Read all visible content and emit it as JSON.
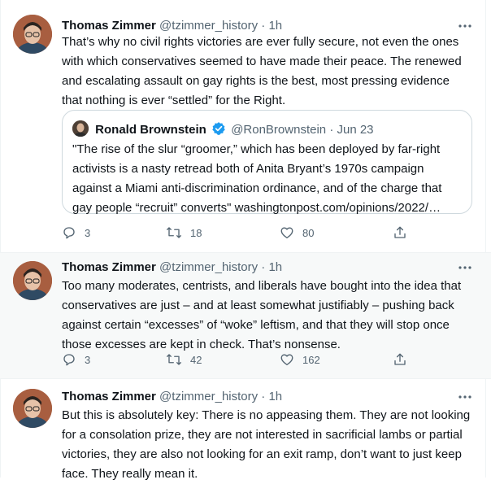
{
  "tweets": [
    {
      "name": "Thomas Zimmer",
      "handle": "@tzimmer_history",
      "sep": "·",
      "time": "1h",
      "text": "That’s why no civil rights victories are ever fully secure, not even the ones with which conservatives seemed to have made their peace. The renewed and escalating assault on gay rights is the best, most pressing evidence that nothing is ever “settled” for the Right.",
      "quote": {
        "name": "Ronald Brownstein",
        "handle": "@RonBrownstein",
        "sep": "·",
        "time": "Jun 23",
        "text": "\"The rise of the slur “groomer,” which has been deployed by far-right activists is a nasty retread both of Anita Bryant’s 1970s campaign against a Miami anti-discrimination ordinance, and of the charge that gay people “recruit” converts\" washingtonpost.com/opinions/2022/…"
      },
      "replies": "3",
      "retweets": "18",
      "likes": "80"
    },
    {
      "name": "Thomas Zimmer",
      "handle": "@tzimmer_history",
      "sep": "·",
      "time": "1h",
      "text": "Too many moderates, centrists, and liberals have bought into the idea that conservatives are just – and at least somewhat justifiably – pushing back against certain “excesses” of “woke” leftism, and that they will stop once those excesses are kept in check. That’s nonsense.",
      "replies": "3",
      "retweets": "42",
      "likes": "162"
    },
    {
      "name": "Thomas Zimmer",
      "handle": "@tzimmer_history",
      "sep": "·",
      "time": "1h",
      "text": "But this is absolutely key: There is no appeasing them. They are not looking for a consolation prize, they are not interested in sacrificial lambs or partial victories, they are also not looking for an exit ramp, don’t want to just keep face. They really mean it."
    }
  ],
  "icons": {
    "more": "more-icon",
    "reply": "reply-icon",
    "retweet": "retweet-icon",
    "like": "like-icon",
    "share": "share-icon",
    "verified": "verified-badge-icon"
  },
  "colors": {
    "text": "#0f1419",
    "muted": "#536471",
    "verified": "#1d9bf0",
    "border": "#cfd9de",
    "highlight": "#f7f9f9"
  }
}
